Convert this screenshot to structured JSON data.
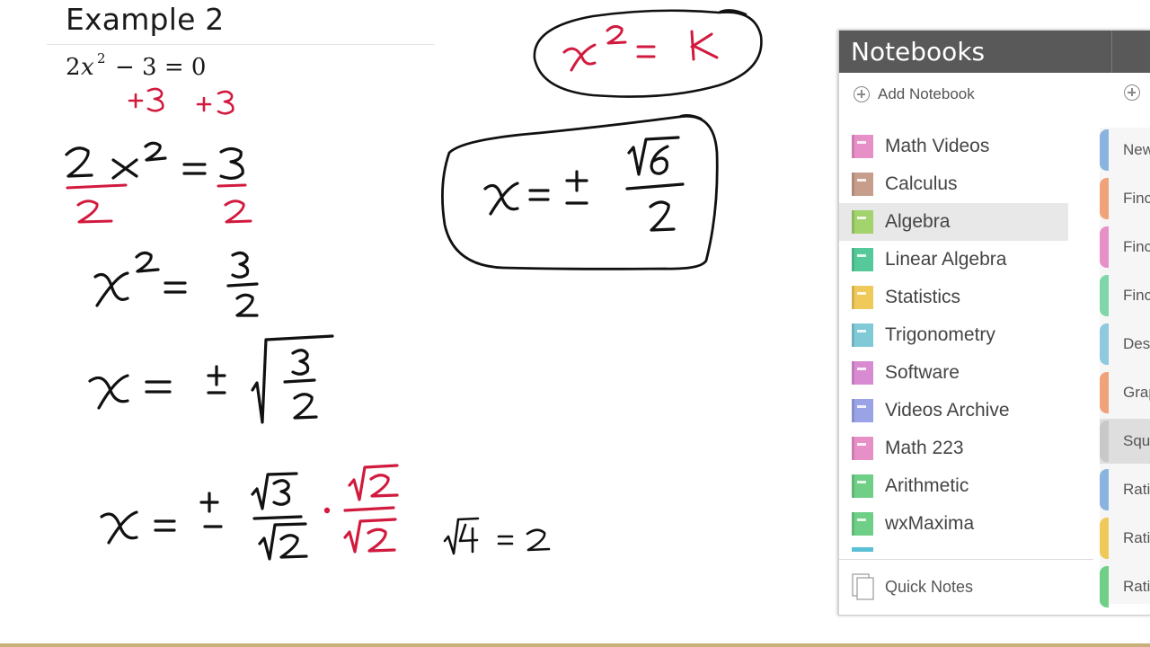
{
  "page": {
    "title": "Example 2"
  },
  "notebooks": {
    "header": "Notebooks",
    "add_label": "Add Notebook",
    "add_section_icon": "plus-circle-icon",
    "items": [
      {
        "label": "Math Videos",
        "color": "#e78fc7"
      },
      {
        "label": "Calculus",
        "color": "#c79e8c"
      },
      {
        "label": "Algebra",
        "color": "#a3d36c",
        "selected": true
      },
      {
        "label": "Linear Algebra",
        "color": "#56c99a"
      },
      {
        "label": "Statistics",
        "color": "#f0c95b"
      },
      {
        "label": "Trigonometry",
        "color": "#7fcad6"
      },
      {
        "label": "Software",
        "color": "#d98bd1"
      },
      {
        "label": "Videos Archive",
        "color": "#9aa3e6"
      },
      {
        "label": "Math 223",
        "color": "#e78fc7"
      },
      {
        "label": "Arithmetic",
        "color": "#6fcf86"
      },
      {
        "label": "wxMaxima",
        "color": "#6fcf86"
      }
    ],
    "quick_notes": "Quick Notes",
    "sections": [
      {
        "label": "New",
        "color": "#8ab4df"
      },
      {
        "label": "Finc",
        "color": "#f0a27a"
      },
      {
        "label": "Finc",
        "color": "#e78fc7"
      },
      {
        "label": "Finc",
        "color": "#7fd6a8"
      },
      {
        "label": "Des",
        "color": "#8ec9df"
      },
      {
        "label": "Grap",
        "color": "#f0a27a"
      },
      {
        "label": "Squ",
        "color": "#c8c8c8",
        "active": true
      },
      {
        "label": "Rati",
        "color": "#8ab4df"
      },
      {
        "label": "Rati",
        "color": "#f0c95b"
      },
      {
        "label": "Rati",
        "color": "#6fcf86"
      }
    ]
  },
  "colors": {
    "ink_black": "#111111",
    "ink_red": "#d11a3e",
    "panel_header": "#595959"
  },
  "math": {
    "typed_equation": "2x² − 3 = 0",
    "handwritten_steps": [
      "+3 +3",
      "2x² = 3 / 2 2",
      "x² = 3/2",
      "x = ± √(3/2)",
      "x = ± √3/√2 · √2/√2",
      "√4 = 2",
      "x² = k",
      "x = ± √6 / 2"
    ]
  },
  "typeset": {
    "two": "2",
    "x": "x",
    "sup2": "2",
    "minus3": "− 3 = 0"
  }
}
